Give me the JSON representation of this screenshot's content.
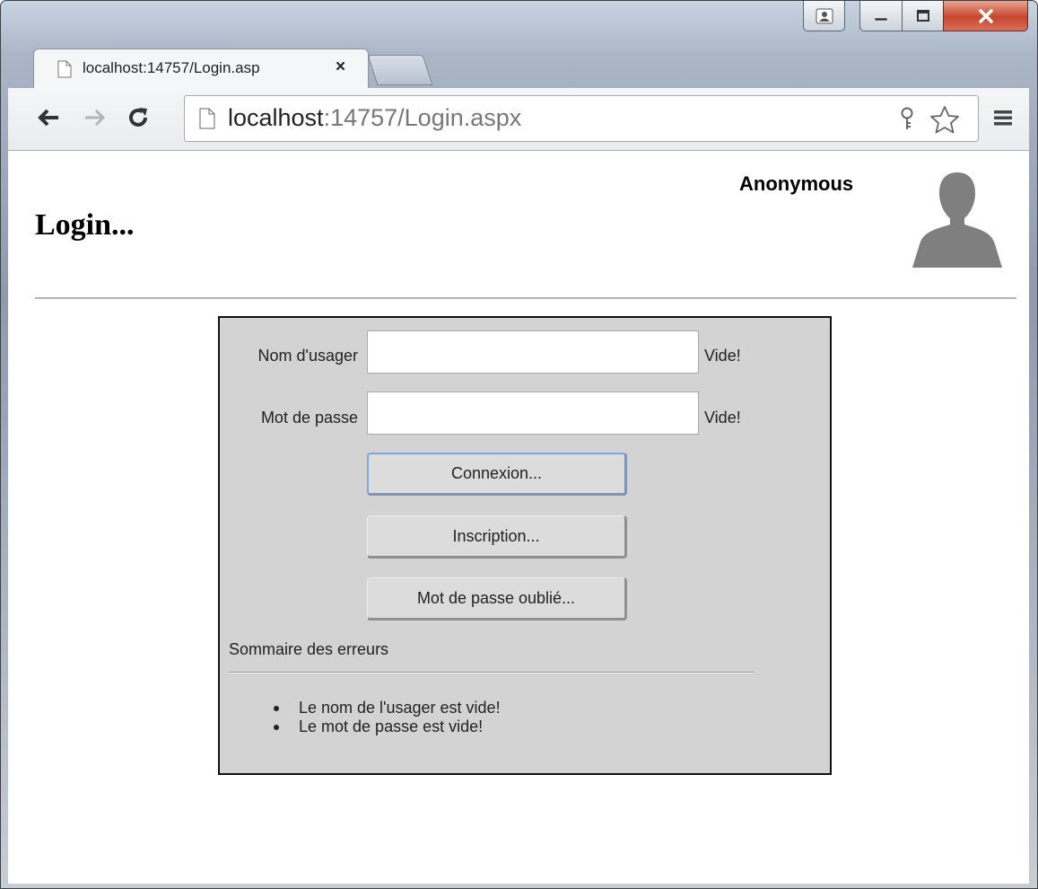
{
  "tab": {
    "title": "localhost:14757/Login.asp",
    "close_glyph": "×"
  },
  "address": {
    "host": "localhost",
    "path": ":14757/Login.aspx"
  },
  "icons": {
    "page": "page-icon",
    "back": "back-arrow-icon",
    "forward": "forward-arrow-icon",
    "reload": "reload-icon",
    "key": "key-icon",
    "star": "star-icon",
    "menu": "menu-icon",
    "avatar": "user-silhouette-icon",
    "profile": "profile-icon",
    "minimize": "minimize-icon",
    "maximize": "maximize-icon",
    "close": "close-icon"
  },
  "header": {
    "title": "Login...",
    "user": "Anonymous"
  },
  "form": {
    "username_label": "Nom d'usager",
    "username_value": "",
    "username_msg": "Vide!",
    "password_label": "Mot de passe",
    "password_value": "",
    "password_msg": "Vide!",
    "login_button": "Connexion...",
    "register_button": "Inscription...",
    "forgot_button": "Mot de passe oublié..."
  },
  "summary": {
    "title": "Sommaire des erreurs",
    "errors": [
      "Le nom de l'usager est vide!",
      "Le mot de passe est vide!"
    ]
  },
  "colors": {
    "panel_bg": "#d3d3d3",
    "close_button": "#c7472e",
    "avatar": "#7f7f7f"
  }
}
